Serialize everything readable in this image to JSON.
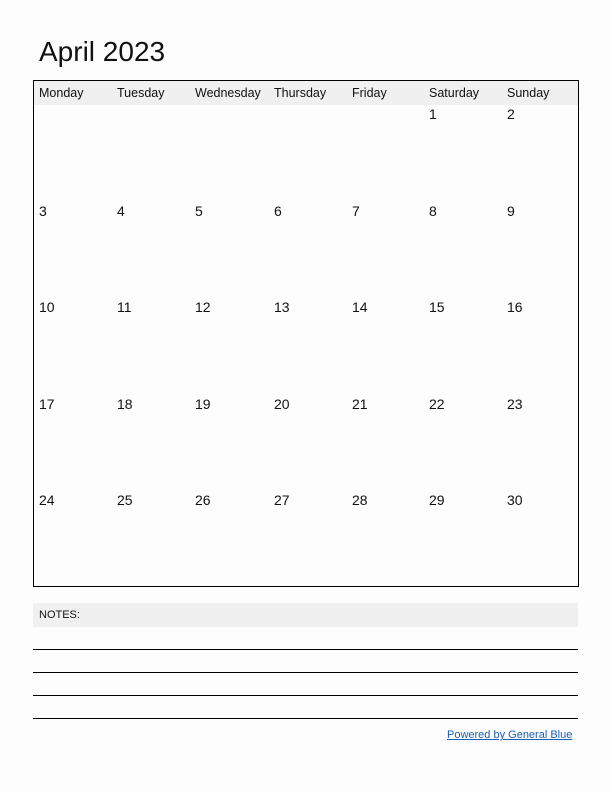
{
  "title": "April 2023",
  "weekdays": [
    "Monday",
    "Tuesday",
    "Wednesday",
    "Thursday",
    "Friday",
    "Saturday",
    "Sunday"
  ],
  "weeks": [
    [
      "",
      "",
      "",
      "",
      "",
      "1",
      "2"
    ],
    [
      "3",
      "4",
      "5",
      "6",
      "7",
      "8",
      "9"
    ],
    [
      "10",
      "11",
      "12",
      "13",
      "14",
      "15",
      "16"
    ],
    [
      "17",
      "18",
      "19",
      "20",
      "21",
      "22",
      "23"
    ],
    [
      "24",
      "25",
      "26",
      "27",
      "28",
      "29",
      "30"
    ]
  ],
  "notes_label": "NOTES:",
  "footer_link": "Powered by General Blue"
}
